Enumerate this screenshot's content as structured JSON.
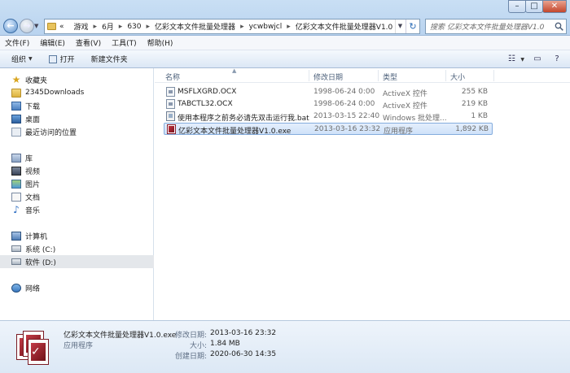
{
  "address": {
    "nav_prefix": "«",
    "crumbs": [
      "游戏",
      "6月",
      "630",
      "亿彩文本文件批量处理器",
      "ycwbwjcl",
      "亿彩文本文件批量处理器V1.0"
    ]
  },
  "search": {
    "placeholder": "搜索 亿彩文本文件批量处理器V1.0"
  },
  "menu": [
    "文件(F)",
    "编辑(E)",
    "查看(V)",
    "工具(T)",
    "帮助(H)"
  ],
  "toolbar": {
    "organize": "组织",
    "open": "打开",
    "new_folder": "新建文件夹"
  },
  "sidebar": {
    "favorites": "收藏夹",
    "fav_items": [
      "2345Downloads",
      "下载",
      "桌面",
      "最近访问的位置"
    ],
    "libraries": "库",
    "lib_items": [
      "视频",
      "图片",
      "文档",
      "音乐"
    ],
    "computer": "计算机",
    "drives": [
      "系统 (C:)",
      "软件 (D:)"
    ],
    "network": "网络"
  },
  "columns": {
    "name": "名称",
    "modified": "修改日期",
    "type": "类型",
    "size": "大小"
  },
  "files": [
    {
      "name": "MSFLXGRD.OCX",
      "modified": "1998-06-24 0:00",
      "type": "ActiveX 控件",
      "size": "255 KB",
      "icon": "ocx-icon"
    },
    {
      "name": "TABCTL32.OCX",
      "modified": "1998-06-24 0:00",
      "type": "ActiveX 控件",
      "size": "219 KB",
      "icon": "ocx-icon"
    },
    {
      "name": "使用本程序之前务必请先双击运行我.bat",
      "modified": "2013-03-15 22:40",
      "type": "Windows 批处理...",
      "size": "1 KB",
      "icon": "bat-icon"
    },
    {
      "name": "亿彩文本文件批量处理器V1.0.exe",
      "modified": "2013-03-16 23:32",
      "type": "应用程序",
      "size": "1,892 KB",
      "icon": "exe-icon"
    }
  ],
  "details": {
    "filename": "亿彩文本文件批量处理器V1.0.exe",
    "filetype": "应用程序",
    "modified_label": "修改日期:",
    "modified_value": "2013-03-16 23:32",
    "size_label": "大小:",
    "size_value": "1.84 MB",
    "created_label": "创建日期:",
    "created_value": "2020-06-30 14:35"
  },
  "colors": {
    "selection": "#cfe2f9",
    "accent": "#2a6bb5"
  }
}
